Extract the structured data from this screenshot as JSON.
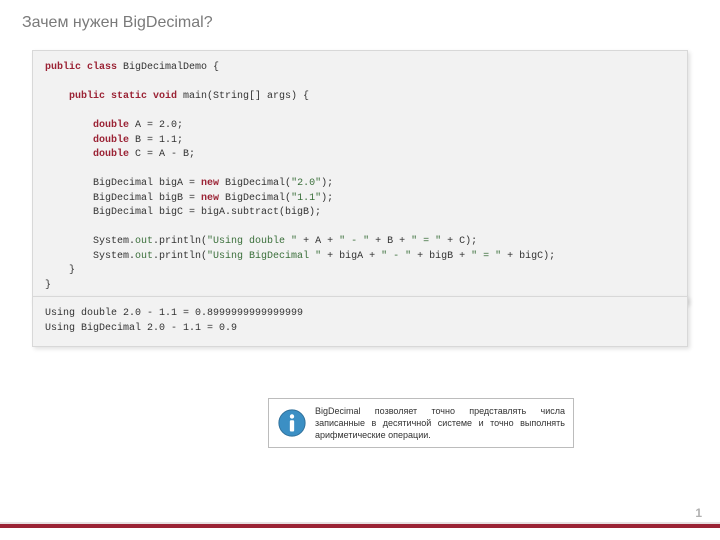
{
  "title": "Зачем нужен BigDecimal?",
  "code": {
    "l01a": "public class",
    "l01b": " BigDecimalDemo {",
    "l02a": "    public static void",
    "l02b": " main(String[] args) {",
    "l03a": "        double",
    "l03b": " A = 2.0;",
    "l04a": "        double",
    "l04b": " B = 1.1;",
    "l05a": "        double",
    "l05b": " C = A - B;",
    "l06a": "        BigDecimal bigA = ",
    "l06b": "new",
    "l06c": " BigDecimal(",
    "l06d": "\"2.0\"",
    "l06e": ");",
    "l07a": "        BigDecimal bigB = ",
    "l07b": "new",
    "l07c": " BigDecimal(",
    "l07d": "\"1.1\"",
    "l07e": ");",
    "l08": "        BigDecimal bigC = bigA.subtract(bigB);",
    "l09a": "        System.",
    "l09b": "out",
    "l09c": ".println(",
    "l09d": "\"Using double \"",
    "l09e": " + A + ",
    "l09f": "\" - \"",
    "l09g": " + B + ",
    "l09h": "\" = \"",
    "l09i": " + C);",
    "l10a": "        System.",
    "l10b": "out",
    "l10c": ".println(",
    "l10d": "\"Using BigDecimal \"",
    "l10e": " + bigA + ",
    "l10f": "\" - \"",
    "l10g": " + bigB + ",
    "l10h": "\" = \"",
    "l10i": " + bigC);",
    "l11": "    }",
    "l12": "}"
  },
  "output": {
    "line1": "Using double 2.0 - 1.1 = 0.8999999999999999",
    "line2": "Using BigDecimal 2.0 - 1.1 = 0.9"
  },
  "info": {
    "text": "BigDecimal позволяет точно представлять числа записанные в десятичной системе и точно выполнять арифметические операции."
  },
  "page_number": "1"
}
